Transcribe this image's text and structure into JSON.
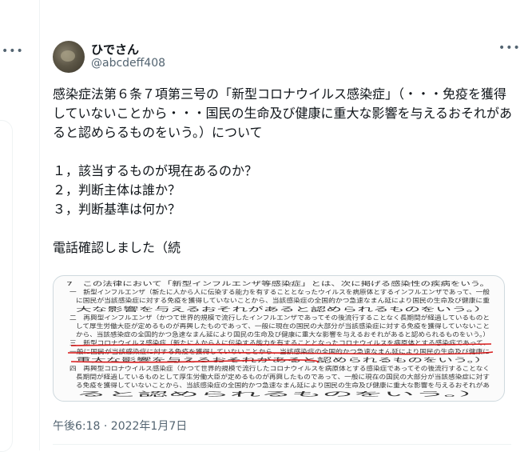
{
  "left_panel": {
    "more_icon": "more-horizontal-icon"
  },
  "tweet": {
    "display_name": "ひでさん",
    "handle": "@abcdeff408",
    "more_icon": "more-horizontal-icon",
    "text": "感染症法第６条７項第三号の「新型コロナウイルス感染症」（・・・免疫を獲得していないことから・・・国民の生命及び健康に重大な影響を与えるおそれがあると認めらるものをいう。）について\n\n１，該当するものが現在あるのか？\n２，判断主体は誰か？\n３，判断基準は何か？\n\n電話確認しました（続",
    "timestamp": "午後6:18 · 2022年1月7日"
  },
  "image": {
    "lines": [
      "7　この法律において「新型インフルエンザ等感染症」とは、次に掲げる感染性の疾病をいう。",
      "一　新型インフルエンザ（新たに人から人に伝染する能力を有することとなったウイルスを病原体とするインフルエンザであって、一般",
      "に国民が当該感染症に対する免疫を獲得していないことから、当該感染症の全国的かつ急速なまん延により国民の生命及び健康に重",
      "大な影響を与えるおそれがあると認められるものをいう。）",
      "二　再興型インフルエンザ（かつて世界的規模で流行したインフルエンザであってその後流行することなく長期間が経過しているものと",
      "して厚生労働大臣が定めるものが再興したものであって、一般に現在の国民の大部分が当該感染症に対する免疫を獲得していないこと",
      "から、当該感染症の全国的かつ急速なまん延により国民の生命及び健康に重大な影響を与えるおそれがあると認められるものをいう。）",
      "三　新型コロナウイルス感染症（新たに人から人に伝染する能力を有することとなったコロナウイルスを病原体とする感染症であって、",
      "一般に国民が当該感染症に対する免疫を獲得していないことから、当該感染症の全国的かつ急速なまん延により国民の生命及び健康に",
      "重大な影響を与えるおそれがあると認められるものをいう。）",
      "四　再興型コロナウイルス感染症（かつて世界的規模で流行したコロナウイルスを病原体とする感染症であってその後流行することなく",
      "長期間が経過しているものとして厚生労働大臣が定めるものが再興したものであって、一般に現在の国民の大部分が当該感染症に対す",
      "る免疫を獲得していないことから、当該感染症の全国的かつ急速なまん延により国民の生命及び健康に重大な影響を与えるおそれがあ",
      "ると認められるものをいう。）"
    ],
    "highlight_color": "#d91a1a"
  }
}
